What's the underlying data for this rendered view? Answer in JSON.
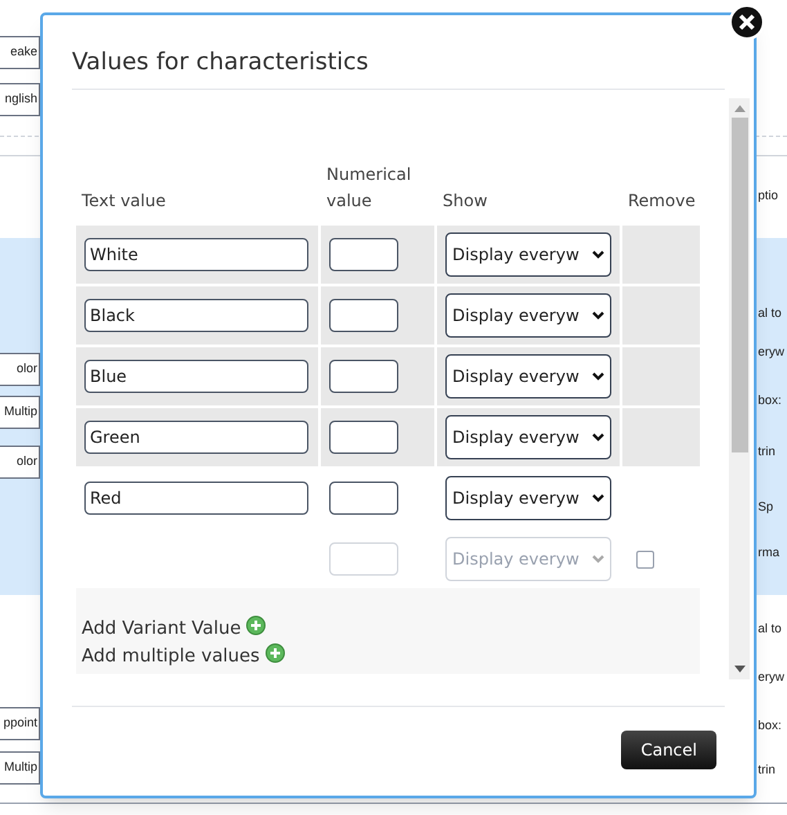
{
  "background_left": [
    "eake",
    "nglish",
    "olor",
    "Multip",
    "olor",
    "ppoint",
    "Multip"
  ],
  "background_right": [
    "ptio",
    "al to",
    "eryw",
    "box:",
    "trin",
    "Sp",
    "rma",
    "al to",
    "eryw",
    "box:",
    "trin"
  ],
  "dialog": {
    "title": "Values for characteristics",
    "columns": [
      "Text value",
      "Numerical value",
      "Show",
      "Remove"
    ],
    "rows": [
      {
        "kind": "value",
        "text": "White",
        "show": "Display everyw",
        "highlighted": true
      },
      {
        "kind": "value",
        "text": "Black",
        "show": "Display everyw",
        "highlighted": true
      },
      {
        "kind": "value",
        "text": "Blue",
        "show": "Display everyw",
        "highlighted": true
      },
      {
        "kind": "value",
        "text": "Green",
        "show": "Display everyw",
        "highlighted": true
      },
      {
        "kind": "value",
        "text": "Red",
        "show": "Display everyw",
        "highlighted": false
      },
      {
        "kind": "new",
        "show": "Display everyw",
        "disabled": true,
        "checked": false
      }
    ],
    "links": [
      "Add Variant Value",
      "Add multiple values"
    ],
    "buttons": [
      "Cancel"
    ]
  }
}
